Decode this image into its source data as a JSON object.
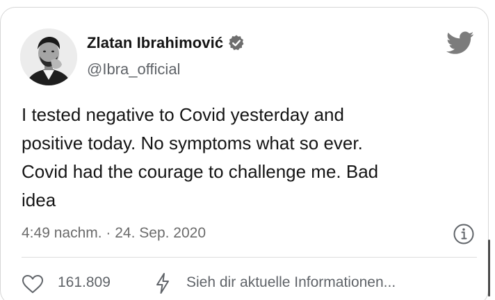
{
  "author": {
    "name": "Zlatan Ibrahimović",
    "handle": "@Ibra_official",
    "verified": true
  },
  "tweet": {
    "lines": [
      "I tested negative to Covid yesterday and",
      "positive today. No symptoms what so ever.",
      "Covid had the courage to challenge me. Bad",
      "idea"
    ],
    "timestamp": "4:49 nachm. · 24. Sep. 2020"
  },
  "actions": {
    "like_count": "161.809",
    "info_link": "Sieh dir aktuelle Informationen..."
  },
  "icons": {
    "logo": "twitter-bird-icon",
    "verified": "verified-badge-icon",
    "info": "info-icon",
    "like": "heart-icon",
    "info_bolt": "lightning-bolt-icon"
  },
  "colors": {
    "text": "#141414",
    "muted": "#5f6368",
    "border": "#d6d6d6"
  }
}
